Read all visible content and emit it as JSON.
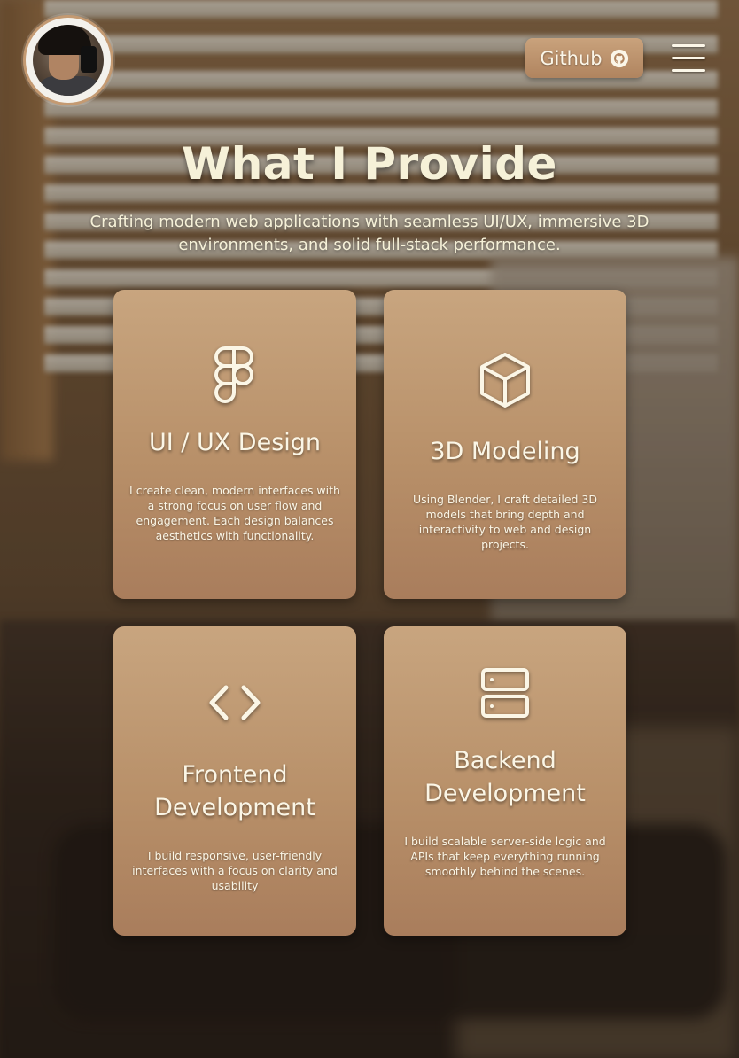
{
  "header": {
    "avatar_alt": "Profile photo",
    "github_label": "Github",
    "github_icon": "github-icon",
    "menu_icon": "hamburger-menu-icon"
  },
  "hero": {
    "title": "What I Provide",
    "subtitle": "Crafting modern web applications with seamless UI/UX, immersive 3D environments, and solid full-stack performance."
  },
  "cards": [
    {
      "icon": "figma-icon",
      "title": "UI / UX Design",
      "description": "I create clean, modern interfaces with a strong focus on user flow and engagement. Each design balances aesthetics with functionality."
    },
    {
      "icon": "cube-icon",
      "title": "3D Modeling",
      "description": "Using Blender, I craft detailed 3D models that bring depth and interactivity to web and design projects."
    },
    {
      "icon": "code-icon",
      "title": "Frontend Development",
      "description": "I build responsive, user-friendly interfaces with a focus on clarity and usability"
    },
    {
      "icon": "server-icon",
      "title": "Backend Development",
      "description": "I build scalable server-side logic and APIs that keep everything running smoothly behind the scenes."
    }
  ],
  "colors": {
    "card_top": "#c8a57f",
    "card_bottom": "#a97d5c",
    "text_light": "#f6f1d8",
    "button": "#c49a72"
  }
}
